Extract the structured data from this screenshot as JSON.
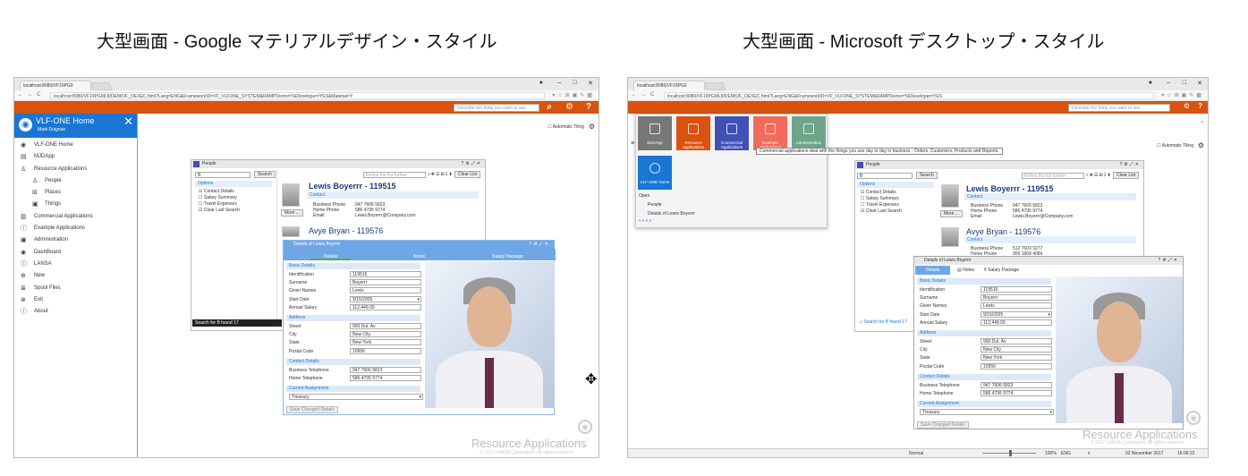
{
  "captions": {
    "left": "大型画面 - Google マテリアルデザイン・スタイル",
    "right": "大型画面 - Microsoft デスクトップ・スタイル"
  },
  "colors": {
    "appbar": "#d9520e",
    "sidebar_header": "#1976d2",
    "dialog_title": "#6fa7e6"
  },
  "left": {
    "browser": {
      "tab": "localhost:8080/VF19PG0",
      "url": "localhost:8080/VF19PGML8/DEM/UF_OEXEC.html?Lang=ENG&FrameworkID=VF_VLFONE_SYSTEM&RAMPDemo=Y&Developer=YES&Material=Y"
    },
    "search_placeholder": "Describe the thing you want to see",
    "automatic_tiling": "Automatic Tiling",
    "sidebar": {
      "title": "VLF-ONE Home",
      "user": "Mark Duignan",
      "items": [
        {
          "label": "VLF-ONE Home",
          "icon": "globe-icon",
          "sub": false
        },
        {
          "label": "MJDApp",
          "icon": "document-icon",
          "sub": false
        },
        {
          "label": "Resource Applications",
          "icon": "person-icon",
          "sub": false
        },
        {
          "label": "People",
          "icon": "person-icon",
          "sub": true
        },
        {
          "label": "Places",
          "icon": "grid-icon",
          "sub": true
        },
        {
          "label": "Things",
          "icon": "clipboard-icon",
          "sub": true
        },
        {
          "label": "Commercial Applications",
          "icon": "chart-icon",
          "sub": false
        },
        {
          "label": "Example Applications",
          "icon": "info-icon",
          "sub": false
        },
        {
          "label": "Administration",
          "icon": "clipboard-icon",
          "sub": false
        },
        {
          "label": "DashBoard",
          "icon": "globe-icon",
          "sub": false
        },
        {
          "label": "LANSA",
          "icon": "info-icon",
          "sub": false
        },
        {
          "label": "New",
          "icon": "plus-icon",
          "sub": false
        },
        {
          "label": "Spool Files",
          "icon": "list-icon",
          "sub": false
        },
        {
          "label": "Exit",
          "icon": "close-icon",
          "sub": false
        },
        {
          "label": "About",
          "icon": "info-icon",
          "sub": false
        }
      ]
    },
    "found": "Search for B found 17"
  },
  "right": {
    "browser": {
      "tab": "localhost:8080/VF19PG0",
      "url": "localhost:8080/VF19PGML8/DEM/UF_OEXEC.html?Lang=ENG&FrameworkID=VF_VLFONE_SYSTEM&RAMPDemo=Y&Developer=YES"
    },
    "search_placeholder": "Describe the thing you want to see",
    "automatic_tiling": "Automatic Tiling",
    "tiles": [
      {
        "label": "MJDApp",
        "color": "#777777"
      },
      {
        "label": "Resource Applications",
        "color": "#d9520e"
      },
      {
        "label": "Commercial Applications",
        "color": "#3f51b5"
      },
      {
        "label": "Example Applications",
        "color": "#f06b5b"
      },
      {
        "label": "Administration",
        "color": "#6ea58a"
      }
    ],
    "home_tile": "VLF-ONE Home",
    "tooltip": "Commercial applications deal with the things you use day to day in business - Orders, Customers, Products and Reports.",
    "menu": {
      "open": "Open",
      "items": [
        "People",
        "Details of Lewis Boyerrr"
      ]
    },
    "found": "Search for B found 17",
    "status": {
      "mode": "Normal",
      "zoom": "100%",
      "lang": "ENG",
      "x": "x",
      "date": "02 November 2017",
      "time": "16:06:22"
    }
  },
  "people": {
    "title": "People",
    "search_value": "B",
    "search_btn": "Search",
    "refine_placeholder": "Refine the list further",
    "clear_btn": "Clear List",
    "options": "Options",
    "checks": [
      {
        "label": "Contact Details",
        "checked": true
      },
      {
        "label": "Salary Summary",
        "checked": false
      },
      {
        "label": "Travel Expenses",
        "checked": false
      },
      {
        "label": "Clear Last Search",
        "checked": true
      }
    ],
    "more_btn": "More ...",
    "person1": {
      "name": "Lewis Boyerrr - 119515",
      "contact": "Contact",
      "labels": [
        "Business Phone",
        "Home Phone",
        "Email"
      ],
      "values": [
        "947 7606 5823",
        "586 4795 9774",
        "Lewis.Boyerrr@Company.com"
      ]
    },
    "person2": {
      "name": "Avye Bryan - 119576",
      "contact": "Contact",
      "labels": [
        "Business Phone",
        "Home Phone"
      ],
      "values": [
        "512 7603 9277",
        "959 1668 4084"
      ]
    }
  },
  "details": {
    "title": "Details of Lewis Boyerrr",
    "tabs": [
      "Details",
      "Notes",
      "Salary Package"
    ],
    "basic": "Basic Details",
    "basic_labels": [
      "Identification",
      "Surname",
      "Given Names",
      "Start Date",
      "Annual Salary"
    ],
    "basic_values": [
      "119515",
      "Boyerrr",
      "Lewis",
      "9/15/2005",
      "112,449.00"
    ],
    "address": "Address",
    "addr_labels": [
      "Street",
      "City",
      "State",
      "Postal Code"
    ],
    "addr_values": [
      "900 Dul. Av.",
      "New City",
      "New York",
      "10956"
    ],
    "contact": "Contact Details",
    "contact_labels": [
      "Business Telephone",
      "Home Telephone"
    ],
    "contact_values": [
      "947 7606 5823",
      "586 4795 9774"
    ],
    "assignment": "Current Assignment",
    "assignment_value": "Treasury",
    "save_btn": "Save Changed Details"
  },
  "watermark": "Resource Applications",
  "copyright": "© 2017 LANSA Corporation. All rights reserved."
}
